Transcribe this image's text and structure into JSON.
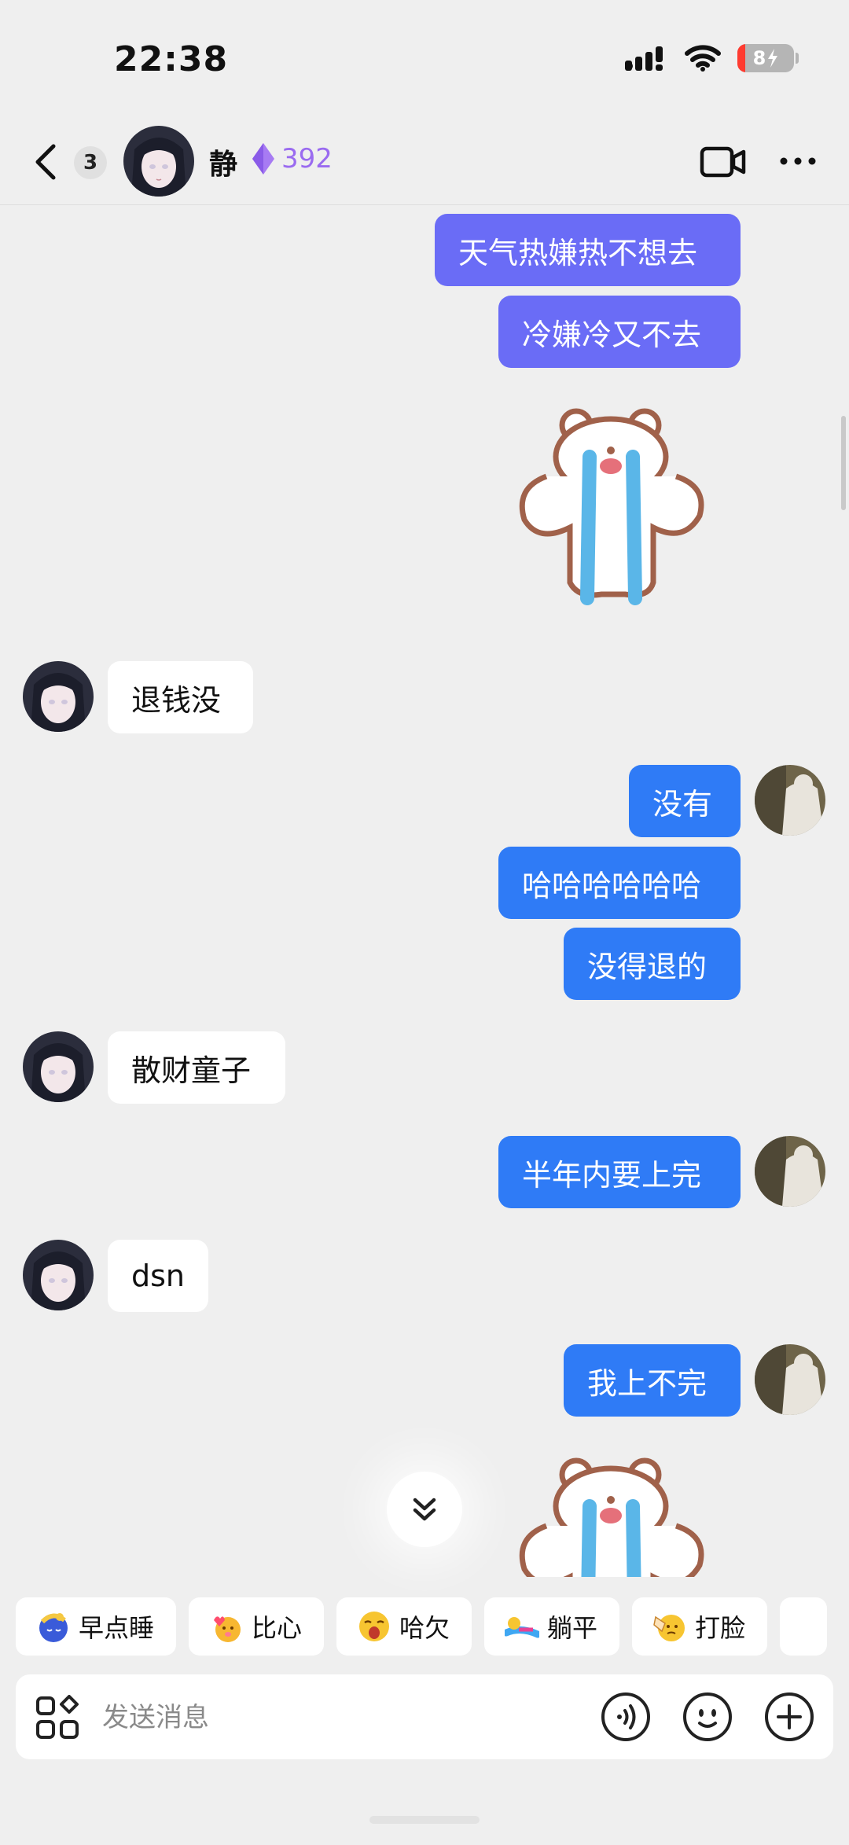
{
  "status_bar": {
    "time": "22:38",
    "battery": "8"
  },
  "nav": {
    "unread_count": "3",
    "contact_name": "静",
    "intimacy_value": "392"
  },
  "messages": [
    {
      "side": "out",
      "text": "天气热嫌热不想去"
    },
    {
      "side": "out",
      "text": "冷嫌冷又不去"
    },
    {
      "side": "out",
      "kind": "sticker",
      "icon": "crying-hamster-sticker"
    },
    {
      "side": "in",
      "text": "退钱没"
    },
    {
      "side": "out",
      "text": "没有"
    },
    {
      "side": "out",
      "text": "哈哈哈哈哈哈"
    },
    {
      "side": "out",
      "text": "没得退的"
    },
    {
      "side": "in",
      "text": "散财童子"
    },
    {
      "side": "out",
      "text": "半年内要上完"
    },
    {
      "side": "in",
      "text": "dsn"
    },
    {
      "side": "out",
      "text": "我上不完"
    },
    {
      "side": "out",
      "kind": "sticker",
      "icon": "crying-hamster-sticker"
    }
  ],
  "quick_replies": [
    {
      "label": "早点睡",
      "icon": "sleepy-moon-icon"
    },
    {
      "label": "比心",
      "icon": "finger-heart-icon"
    },
    {
      "label": "哈欠",
      "icon": "yawn-face-icon"
    },
    {
      "label": "躺平",
      "icon": "lie-flat-icon"
    },
    {
      "label": "打脸",
      "icon": "face-slap-icon"
    }
  ],
  "input": {
    "placeholder": "发送消息"
  },
  "colors": {
    "outgoing_bubble": "#2f7bf6",
    "outgoing_bubble_alt": "#6a6cf6",
    "intimacy": "#9a6bf0",
    "background": "#efefef"
  }
}
